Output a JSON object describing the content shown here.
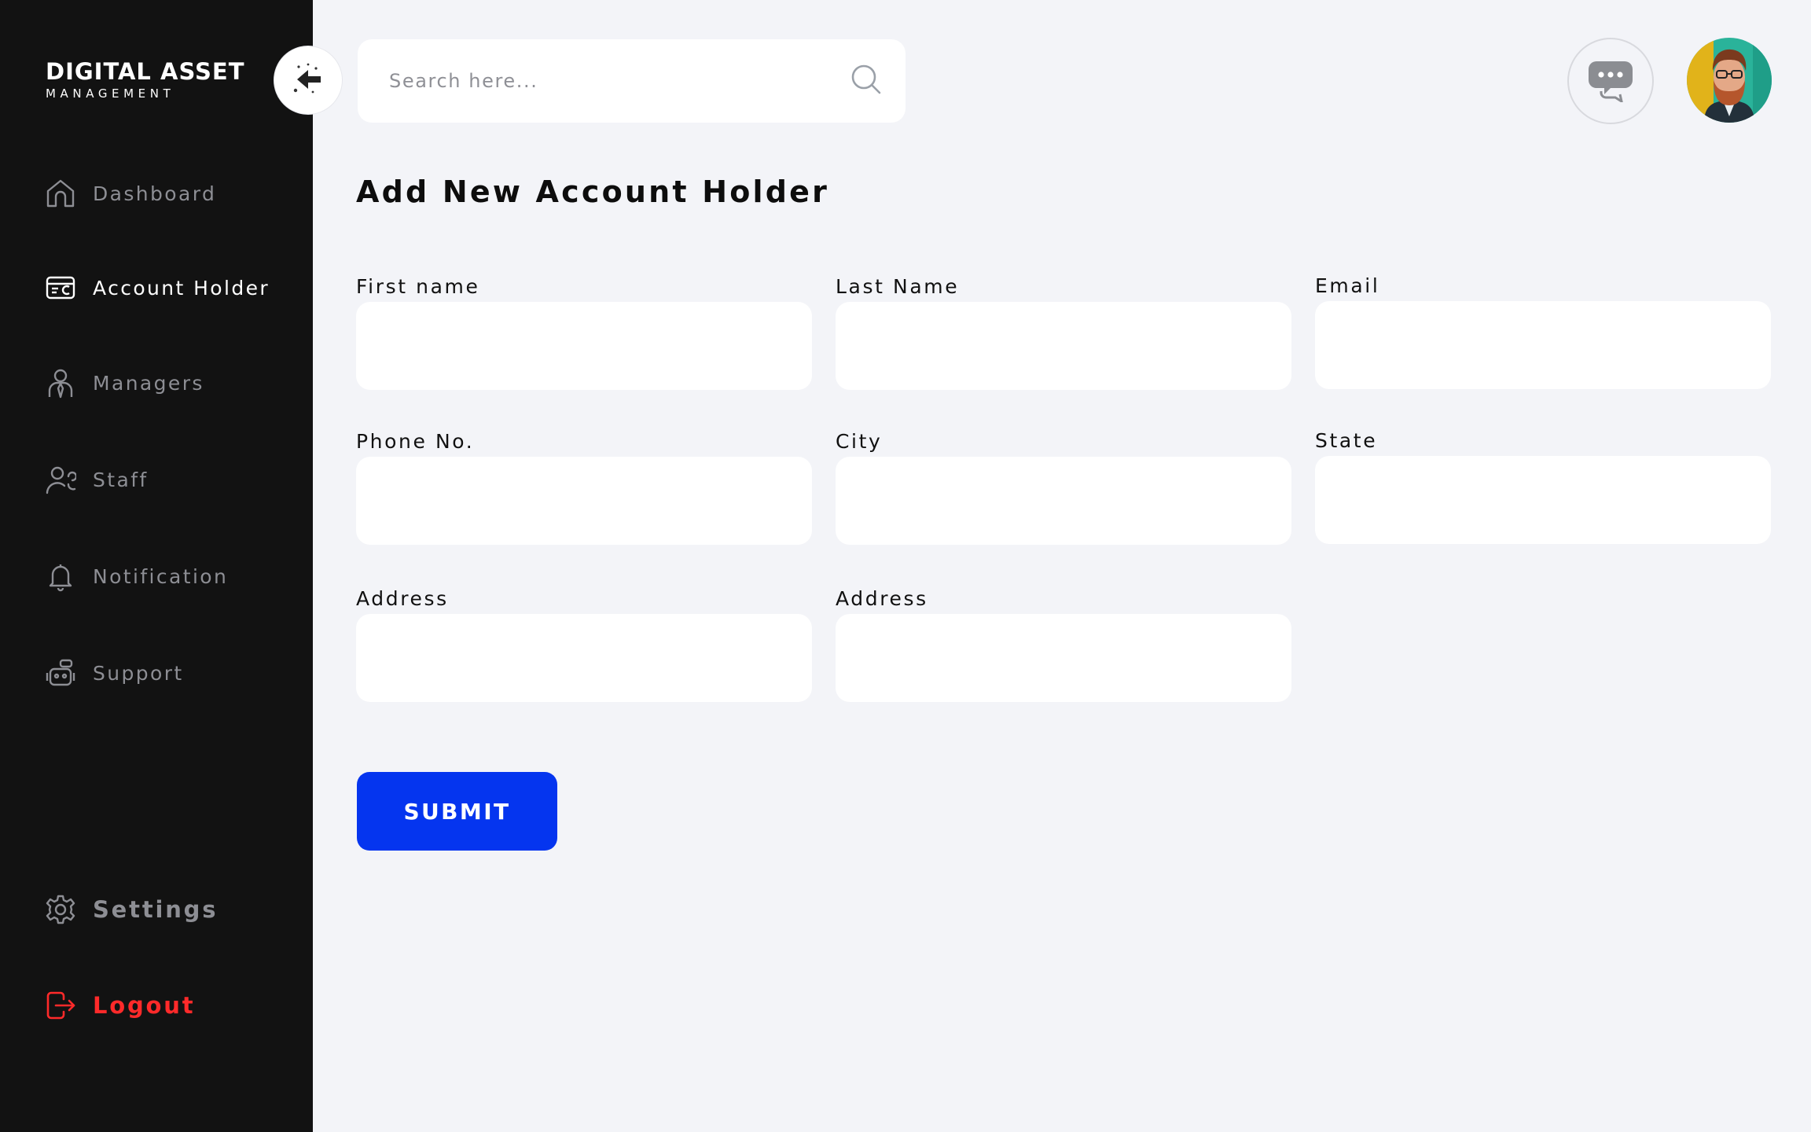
{
  "brand": {
    "title": "DIGITAL ASSET",
    "subtitle": "MANAGEMENT"
  },
  "sidebar": {
    "items": [
      {
        "label": "Dashboard",
        "icon": "home-icon",
        "active": false
      },
      {
        "label": "Account Holder",
        "icon": "wallet-card-icon",
        "active": true
      },
      {
        "label": "Managers",
        "icon": "manager-icon",
        "active": false
      },
      {
        "label": "Staff",
        "icon": "staff-icon",
        "active": false
      },
      {
        "label": "Notification",
        "icon": "bell-icon",
        "active": false
      },
      {
        "label": "Support",
        "icon": "robot-support-icon",
        "active": false
      }
    ],
    "settings_label": "Settings",
    "logout_label": "Logout"
  },
  "header": {
    "search_placeholder": "Search here...",
    "search_icon": "search-icon",
    "chat_icon": "chat-bubble-icon",
    "avatar_icon": "user-avatar"
  },
  "form": {
    "title": "Add New Account Holder",
    "fields": [
      {
        "label": "First name",
        "value": ""
      },
      {
        "label": "Last Name",
        "value": ""
      },
      {
        "label": "Email",
        "value": ""
      },
      {
        "label": "Phone No.",
        "value": ""
      },
      {
        "label": "City",
        "value": ""
      },
      {
        "label": "State",
        "value": ""
      },
      {
        "label": "Address",
        "value": ""
      },
      {
        "label": "Address",
        "value": ""
      }
    ],
    "submit_label": "SUBMIT"
  },
  "colors": {
    "sidebar_bg": "#121212",
    "page_bg": "#f3f4f8",
    "accent": "#0535ef",
    "logout": "#ff2a2a"
  }
}
